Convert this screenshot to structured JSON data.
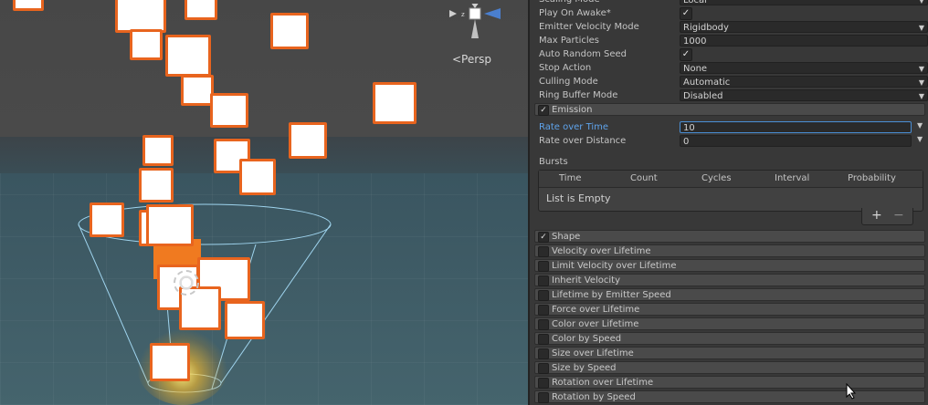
{
  "scene": {
    "camera_mode_label": "<Persp",
    "gizmo": "axis-gizmo-icon"
  },
  "inspector": {
    "top_rows": [
      {
        "label": "Scaling Mode",
        "value": "Local",
        "kind": "dropdown"
      },
      {
        "label": "Play On Awake*",
        "value": "✓",
        "kind": "checkbox"
      },
      {
        "label": "Emitter Velocity Mode",
        "value": "Rigidbody",
        "kind": "dropdown"
      },
      {
        "label": "Max Particles",
        "value": "1000",
        "kind": "field"
      },
      {
        "label": "Auto Random Seed",
        "value": "✓",
        "kind": "checkbox"
      },
      {
        "label": "Stop Action",
        "value": "None",
        "kind": "dropdown"
      },
      {
        "label": "Culling Mode",
        "value": "Automatic",
        "kind": "dropdown"
      },
      {
        "label": "Ring Buffer Mode",
        "value": "Disabled",
        "kind": "dropdown"
      }
    ],
    "emission": {
      "header": "Emission",
      "checked": "✓",
      "rate_over_time_label": "Rate over Time",
      "rate_over_time_value": "10",
      "rate_over_distance_label": "Rate over Distance",
      "rate_over_distance_value": "0",
      "bursts_label": "Bursts",
      "bursts_columns": [
        "Time",
        "Count",
        "Cycles",
        "Interval",
        "Probability"
      ],
      "bursts_empty": "List is Empty",
      "add_label": "+",
      "remove_label": "−"
    },
    "modules": [
      {
        "label": "Shape",
        "checked": "✓"
      },
      {
        "label": "Velocity over Lifetime",
        "checked": ""
      },
      {
        "label": "Limit Velocity over Lifetime",
        "checked": ""
      },
      {
        "label": "Inherit Velocity",
        "checked": ""
      },
      {
        "label": "Lifetime by Emitter Speed",
        "checked": ""
      },
      {
        "label": "Force over Lifetime",
        "checked": ""
      },
      {
        "label": "Color over Lifetime",
        "checked": ""
      },
      {
        "label": "Color by Speed",
        "checked": ""
      },
      {
        "label": "Size over Lifetime",
        "checked": ""
      },
      {
        "label": "Size by Speed",
        "checked": ""
      },
      {
        "label": "Rotation over Lifetime",
        "checked": ""
      },
      {
        "label": "Rotation by Speed",
        "checked": ""
      }
    ],
    "colors": {
      "accent": "#4a8fd6",
      "particle_border": "#e8641e"
    }
  }
}
